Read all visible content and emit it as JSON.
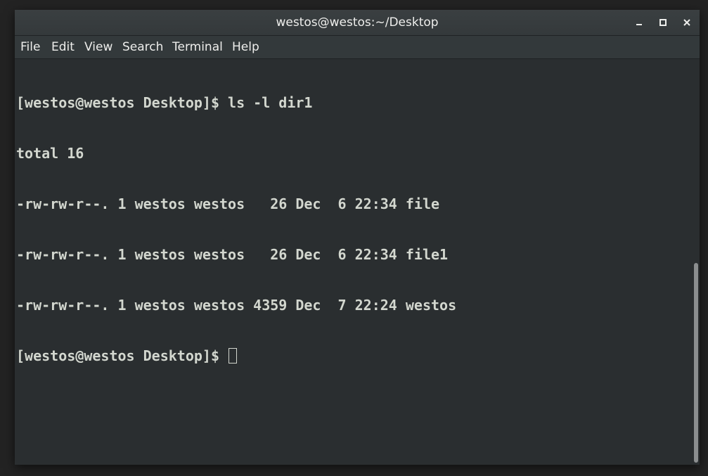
{
  "window": {
    "title": "westos@westos:~/Desktop",
    "controls": {
      "minimize_icon": "minimize-icon",
      "maximize_icon": "maximize-icon",
      "close_icon": "close-icon"
    }
  },
  "menubar": {
    "items": [
      {
        "label": "File"
      },
      {
        "label": "Edit"
      },
      {
        "label": "View"
      },
      {
        "label": "Search"
      },
      {
        "label": "Terminal"
      },
      {
        "label": "Help"
      }
    ]
  },
  "terminal": {
    "lines": [
      "[westos@westos Desktop]$ ls -l dir1",
      "total 16",
      "-rw-rw-r--. 1 westos westos   26 Dec  6 22:34 file",
      "-rw-rw-r--. 1 westos westos   26 Dec  6 22:34 file1",
      "-rw-rw-r--. 1 westos westos 4359 Dec  7 22:24 westos"
    ],
    "prompt": "[westos@westos Desktop]$ "
  },
  "colors": {
    "background": "#2a2e30",
    "text": "#d3d7cf",
    "titlebar": "#373c3e",
    "menubar": "#33393b"
  }
}
